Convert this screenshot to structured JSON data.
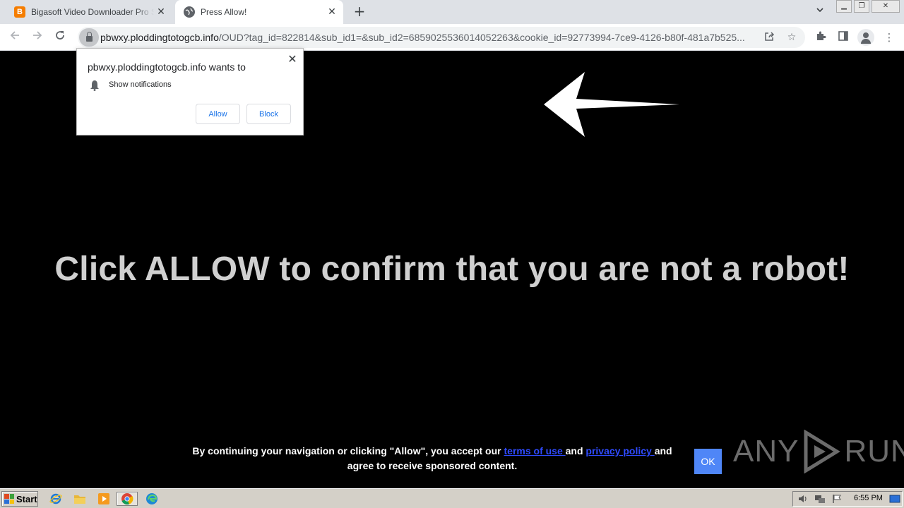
{
  "browser": {
    "tabs": [
      {
        "title": "Bigasoft Video Downloader Pro Serial",
        "favicon": "blogger-icon",
        "favicon_glyph": "B"
      },
      {
        "title": "Press Allow!",
        "favicon": "globe-icon"
      }
    ],
    "new_tab_glyph": "+",
    "url_host": "pbwxy.ploddingtotogcb.info",
    "url_path": "/OUD?tag_id=822814&sub_id1=&sub_id2=6859025536014052263&cookie_id=92773994-7ce9-4126-b80f-481a7b525..."
  },
  "permission_popup": {
    "title": "pbwxy.ploddingtotogcb.info wants to",
    "permission": "Show notifications",
    "allow_label": "Allow",
    "block_label": "Block"
  },
  "page": {
    "headline": "Click ALLOW to confirm that you are not a robot!",
    "consent_before": "By continuing your navigation or clicking \"Allow\", you accept our ",
    "terms_link": "terms of use ",
    "consent_and": "and ",
    "privacy_link": "privacy policy ",
    "consent_after": "and agree to receive sponsored content.",
    "ok_label": "OK",
    "watermark": "ANY RUN",
    "watermark_left": "ANY",
    "watermark_right": "RUN",
    "colors": {
      "background": "#000000",
      "headline": "#d0d0d0",
      "link": "#2f4bff",
      "ok_button": "#4f86f7"
    }
  },
  "taskbar": {
    "start_label": "Start",
    "clock": "6:55 PM"
  }
}
